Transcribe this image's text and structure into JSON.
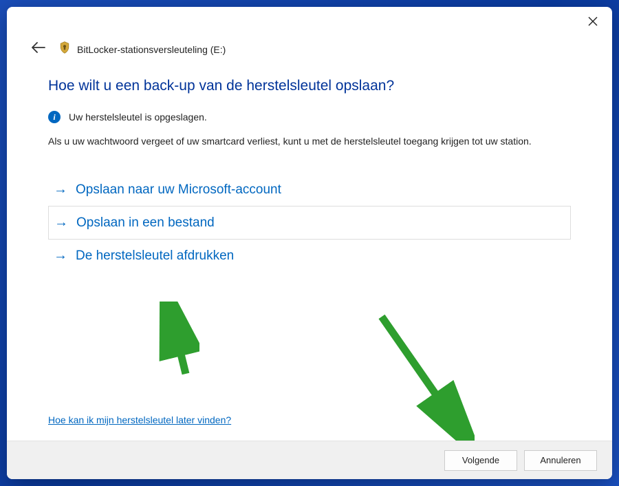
{
  "window": {
    "title": "BitLocker-stationsversleuteling (E:)"
  },
  "page": {
    "heading": "Hoe wilt u een back-up van de herstelsleutel opslaan?",
    "info_text": "Uw herstelsleutel is opgeslagen.",
    "description": "Als u uw wachtwoord vergeet of uw smartcard verliest, kunt u met de herstelsleutel toegang krijgen tot uw station."
  },
  "options": [
    {
      "label": "Opslaan naar uw Microsoft-account",
      "selected": false
    },
    {
      "label": "Opslaan in een bestand",
      "selected": true
    },
    {
      "label": "De herstelsleutel afdrukken",
      "selected": false
    }
  ],
  "help_link": "Hoe kan ik mijn herstelsleutel later vinden?",
  "buttons": {
    "next": "Volgende",
    "cancel": "Annuleren"
  },
  "colors": {
    "accent": "#0067c0",
    "heading": "#003399",
    "arrow": "#2e9e2e"
  }
}
